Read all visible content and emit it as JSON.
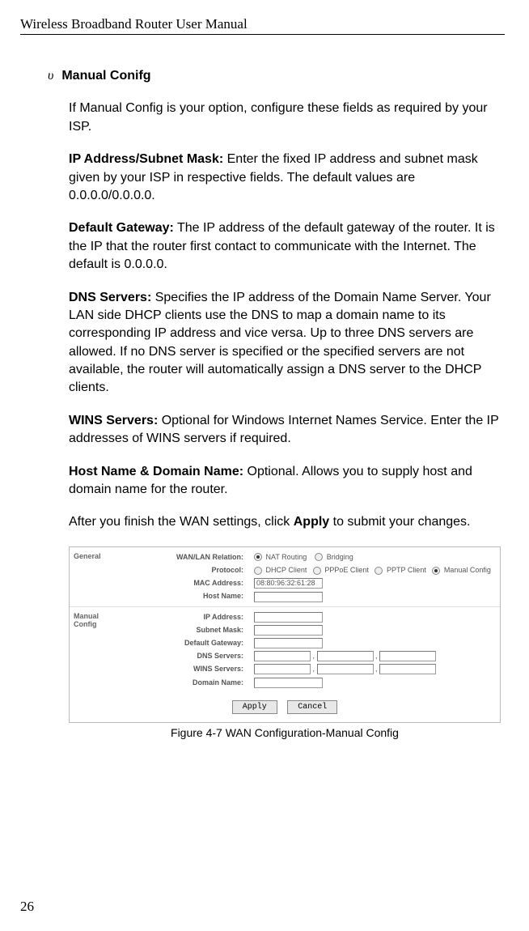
{
  "header": "Wireless Broadband Router User Manual",
  "bullet": "υ",
  "section_title": "Manual Conifg",
  "p1": "If Manual Config is your option, configure these fields as required by your ISP.",
  "p2_label": "IP Address/Subnet Mask:",
  "p2_text": " Enter the fixed IP address and subnet mask given by your ISP in respective fields. The default values are 0.0.0.0/0.0.0.0.",
  "p3_label": "Default Gateway:",
  "p3_text": " The IP address of the default gateway of the router. It is the IP that the router first contact to communicate with the Internet. The default is 0.0.0.0.",
  "p4_label": "DNS Servers:",
  "p4_text": " Specifies the IP address of the Domain Name Server. Your LAN side DHCP clients use the DNS to map a domain name to its corresponding IP address and vice versa. Up to three DNS servers are allowed. If no DNS server is specified or the specified servers are not available, the router will automatically assign a DNS server to the DHCP clients.",
  "p5_label": "WINS Servers:",
  "p5_text": " Optional for Windows Internet Names Service. Enter the IP addresses of WINS servers if required.",
  "p6_label": "Host Name & Domain Name:",
  "p6_text": " Optional. Allows you to supply host and domain name for the router.",
  "p7a": "After you finish the WAN settings, click ",
  "p7b": "Apply",
  "p7c": " to submit your changes.",
  "fig": {
    "sect1": "General",
    "sect2": "Manual Config",
    "labels": {
      "wanlan": "WAN/LAN Relation:",
      "proto": "Protocol:",
      "mac": "MAC Address:",
      "host": "Host Name:",
      "ip": "IP Address:",
      "subnet": "Subnet Mask:",
      "gateway": "Default Gateway:",
      "dns": "DNS Servers:",
      "wins": "WINS Servers:",
      "domain": "Domain Name:"
    },
    "radios": {
      "nat": "NAT Routing",
      "bridge": "Bridging",
      "dhcp": "DHCP Client",
      "pppoe": "PPPoE Client",
      "pptp": "PPTP Client",
      "manual": "Manual Config"
    },
    "mac_value": "08:80:96:32:61:28",
    "btn_apply": "Apply",
    "btn_cancel": "Cancel"
  },
  "fig_caption": "Figure 4-7    WAN Configuration-Manual Config",
  "page_num": "26"
}
